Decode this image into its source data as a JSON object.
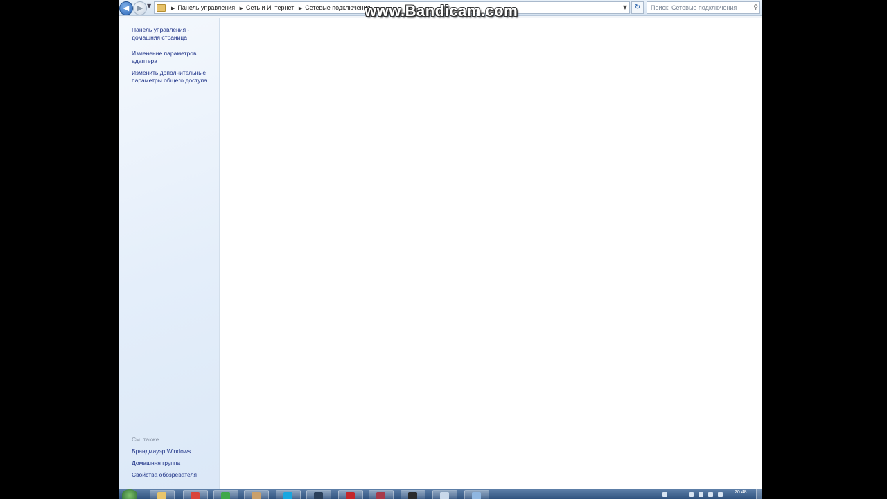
{
  "address_bar": {
    "crumbs": [
      "Панель управления",
      "Сеть и Интернет",
      "Сетевые подключения"
    ],
    "search_placeholder": "Поиск: Сетевые подключения"
  },
  "sidebar": {
    "links": [
      {
        "line1": "Панель управления -",
        "line2": "домашняя страница"
      },
      {
        "line1": "Изменение параметров",
        "line2": "адаптера"
      },
      {
        "line1": "Изменить дополнительные",
        "line2": "параметры общего доступа"
      }
    ],
    "see_also_title": "См. также",
    "see_also": [
      "Брандмауэр Windows",
      "Домашняя группа",
      "Свойства обозревателя"
    ]
  },
  "taskbar": {
    "clock": "20:48",
    "apps": [
      {
        "icon": "explorer-folder-icon",
        "color": "#e9c56a"
      },
      {
        "icon": "chrome-icon",
        "color": "#d9443a"
      },
      {
        "icon": "green-app-icon",
        "color": "#3fa84a"
      },
      {
        "icon": "archive-icon",
        "color": "#c9a06b"
      },
      {
        "icon": "skype-icon",
        "color": "#18a7e0"
      },
      {
        "icon": "steam-icon",
        "color": "#2a3f5a"
      },
      {
        "icon": "red-app-icon",
        "color": "#c4272b"
      },
      {
        "icon": "fan-icon",
        "color": "#a83a4a"
      },
      {
        "icon": "media-icon",
        "color": "#2b2b2b"
      },
      {
        "icon": "window-icon",
        "color": "#c9d8ea"
      },
      {
        "icon": "network-window-icon",
        "color": "#8fb6e0"
      }
    ]
  },
  "watermark": "www.Bandicam.com"
}
